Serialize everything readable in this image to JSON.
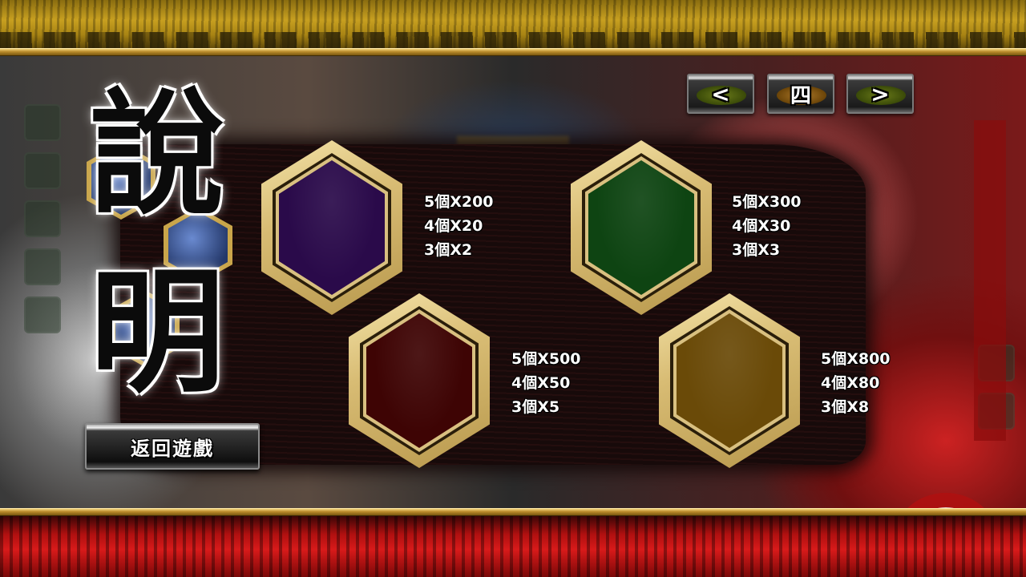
{
  "title": {
    "char1": "說",
    "char2": "明"
  },
  "nav": {
    "prev_label": "<",
    "page_label": "四",
    "next_label": ">"
  },
  "symbols": [
    {
      "name": "purple",
      "color": "#2a0a4a",
      "payouts": [
        "5個X200",
        "4個X20",
        "3個X2"
      ]
    },
    {
      "name": "green",
      "color": "#0e4412",
      "payouts": [
        "5個X300",
        "4個X30",
        "3個X3"
      ]
    },
    {
      "name": "red",
      "color": "#3e0404",
      "payouts": [
        "5個X500",
        "4個X50",
        "3個X5"
      ]
    },
    {
      "name": "brown",
      "color": "#6a4a08",
      "payouts": [
        "5個X800",
        "4個X80",
        "3個X8"
      ]
    }
  ],
  "back_button": {
    "label": "返回遊戲"
  }
}
